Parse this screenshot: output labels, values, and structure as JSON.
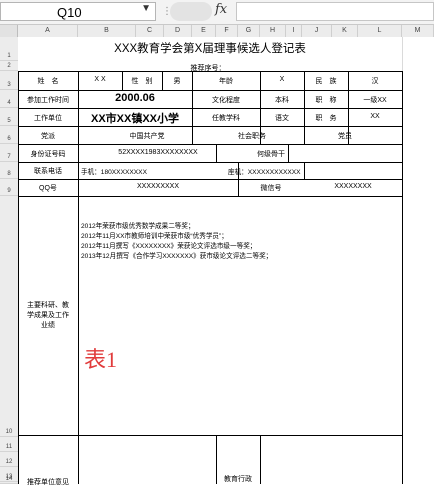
{
  "formula_bar": {
    "cell_ref": "Q10",
    "fx_label": "fx",
    "dropdown_icon": "chevron-down-icon"
  },
  "columns": [
    "A",
    "B",
    "C",
    "D",
    "E",
    "F",
    "G",
    "H",
    "I",
    "J",
    "K",
    "L",
    "M"
  ],
  "rows": [
    "1",
    "2",
    "3",
    "4",
    "5",
    "6",
    "7",
    "8",
    "9",
    "10",
    "11",
    "12",
    "13",
    "14"
  ],
  "form": {
    "title": "XXX教育学会第X届理事候选人登记表",
    "serial_label": "推荐序号：",
    "name_label": "姓　名",
    "name_value": "X X",
    "gender_label": "性　别",
    "gender_value": "男",
    "age_label": "年龄",
    "age_value": "X",
    "ethnicity_label": "民　族",
    "ethnicity_value": "汉",
    "work_start_label": "参加工作时间",
    "work_start_value": "2000.06",
    "education_label": "文化程度",
    "education_value": "本科",
    "title_rank_label": "职　称",
    "title_rank_value": "一级XX",
    "workplace_label": "工作单位",
    "workplace_value": "XX市XX镇XX小学",
    "subject_label": "任教学科",
    "subject_value": "语文",
    "position_label": "职　务",
    "position_value": "XX",
    "party_label": "党派",
    "party_value": "中国共产党",
    "social_label": "社会职务",
    "social_value": "党员",
    "id_label": "身份证号码",
    "id_value": "52XXXX1983XXXXXXXX",
    "honor_label": "何级骨干",
    "phone_label": "联系电话",
    "mobile_text": "手机：180XXXXXXXX",
    "landline_text": "座机：XXXXXXXXXXXX",
    "qq_label": "QQ号",
    "qq_value": "XXXXXXXXX",
    "wechat_label": "微信号",
    "wechat_value": "XXXXXXXX",
    "research_label_1": "主要科研、教",
    "research_label_2": "学成果及工作",
    "research_label_3": "业绩",
    "achievements": [
      "2012年荣获市级优秀数学成果二等奖；",
      "2012年11月XX市教师培训中荣获市级“优秀学员”；",
      "2012年11月撰写《XXXXXXXX》荣获论文评选市级一等奖；",
      "2013年12月撰写《合作学习XXXXXXX》获市级论文评选二等奖；"
    ],
    "overlay_mark": "表1",
    "bottom_label_left": "推荐单位意见",
    "bottom_label_right": "教育行政"
  }
}
